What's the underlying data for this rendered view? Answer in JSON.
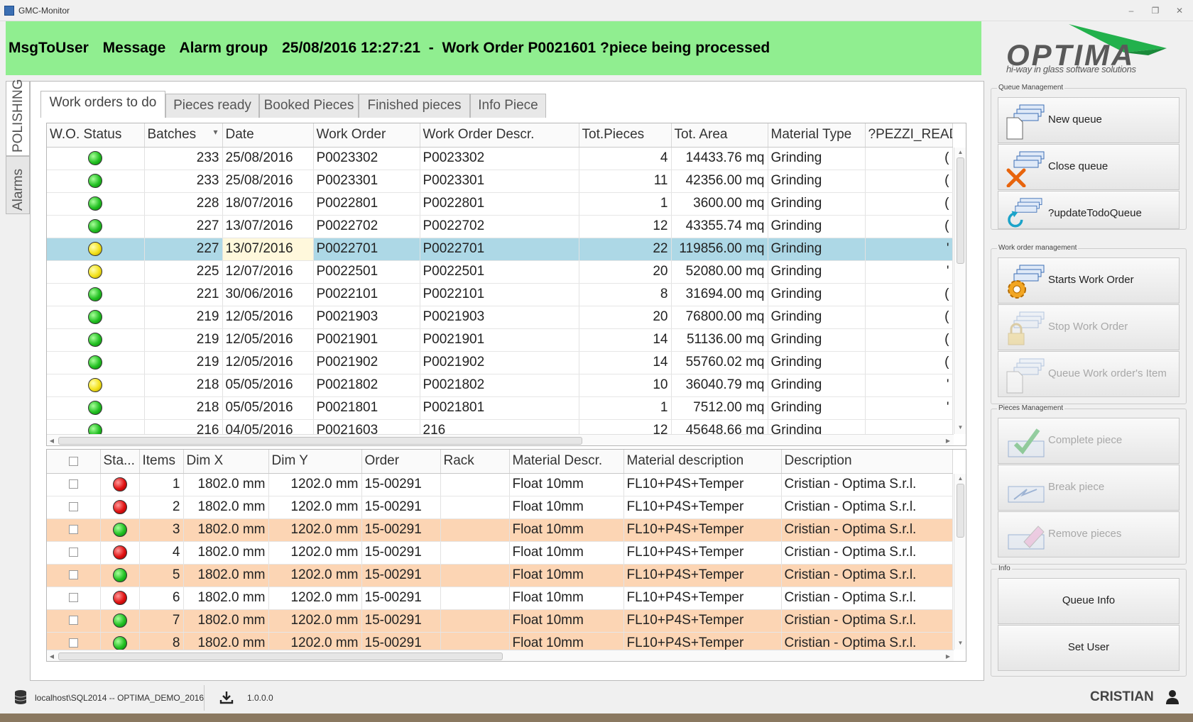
{
  "window": {
    "title": "GMC-Monitor",
    "min": "‒",
    "restore": "❐",
    "close": "✕"
  },
  "banner": {
    "msg_to_user": "MsgToUser",
    "message": "Message",
    "alarm_group": "Alarm group",
    "text": "25/08/2016 12:27:21  -  Work Order P0021601 ?piece being processed",
    "color": "#90ee90"
  },
  "logo": {
    "word": "OPTIMA",
    "tagline": "hi-way in glass software solutions",
    "accent": "#22b14c"
  },
  "side_tabs": [
    "POLISHING",
    "Alarms"
  ],
  "tabs": [
    "Work orders to do",
    "Pieces ready",
    "Booked Pieces",
    "Finished pieces",
    "Info Piece"
  ],
  "work_orders": {
    "columns": [
      "W.O. Status",
      "Batches",
      "Date",
      "Work Order",
      "Work Order Descr.",
      "Tot.Pieces",
      "Tot. Area",
      "Material Type",
      "?PEZZI_READY"
    ],
    "sort_indicator": "▾",
    "rows": [
      {
        "status": "green",
        "batches": "233",
        "date": "25/08/2016",
        "wo": "P0023302",
        "descr": "P0023302",
        "pieces": "4",
        "area": "14433.76 mq",
        "material": "Grinding",
        "ready": "("
      },
      {
        "status": "green",
        "batches": "233",
        "date": "25/08/2016",
        "wo": "P0023301",
        "descr": "P0023301",
        "pieces": "11",
        "area": "42356.00 mq",
        "material": "Grinding",
        "ready": "("
      },
      {
        "status": "green",
        "batches": "228",
        "date": "18/07/2016",
        "wo": "P0022801",
        "descr": "P0022801",
        "pieces": "1",
        "area": "3600.00 mq",
        "material": "Grinding",
        "ready": "("
      },
      {
        "status": "green",
        "batches": "227",
        "date": "13/07/2016",
        "wo": "P0022702",
        "descr": "P0022702",
        "pieces": "12",
        "area": "43355.74 mq",
        "material": "Grinding",
        "ready": "("
      },
      {
        "status": "yellow",
        "batches": "227",
        "date": "13/07/2016",
        "wo": "P0022701",
        "descr": "P0022701",
        "pieces": "22",
        "area": "119856.00 mq",
        "material": "Grinding",
        "ready": "'",
        "selected": true
      },
      {
        "status": "yellow",
        "batches": "225",
        "date": "12/07/2016",
        "wo": "P0022501",
        "descr": "P0022501",
        "pieces": "20",
        "area": "52080.00 mq",
        "material": "Grinding",
        "ready": "'"
      },
      {
        "status": "green",
        "batches": "221",
        "date": "30/06/2016",
        "wo": "P0022101",
        "descr": "P0022101",
        "pieces": "8",
        "area": "31694.00 mq",
        "material": "Grinding",
        "ready": "("
      },
      {
        "status": "green",
        "batches": "219",
        "date": "12/05/2016",
        "wo": "P0021903",
        "descr": "P0021903",
        "pieces": "20",
        "area": "76800.00 mq",
        "material": "Grinding",
        "ready": "("
      },
      {
        "status": "green",
        "batches": "219",
        "date": "12/05/2016",
        "wo": "P0021901",
        "descr": "P0021901",
        "pieces": "14",
        "area": "51136.00 mq",
        "material": "Grinding",
        "ready": "("
      },
      {
        "status": "green",
        "batches": "219",
        "date": "12/05/2016",
        "wo": "P0021902",
        "descr": "P0021902",
        "pieces": "14",
        "area": "55760.02 mq",
        "material": "Grinding",
        "ready": "("
      },
      {
        "status": "yellow",
        "batches": "218",
        "date": "05/05/2016",
        "wo": "P0021802",
        "descr": "P0021802",
        "pieces": "10",
        "area": "36040.79 mq",
        "material": "Grinding",
        "ready": "'"
      },
      {
        "status": "green",
        "batches": "218",
        "date": "05/05/2016",
        "wo": "P0021801",
        "descr": "P0021801",
        "pieces": "1",
        "area": "7512.00 mq",
        "material": "Grinding",
        "ready": "'"
      },
      {
        "status": "green",
        "batches": "216",
        "date": "04/05/2016",
        "wo": "P0021603",
        "descr": "216",
        "pieces": "12",
        "area": "45648.66 mq",
        "material": "Grinding",
        "ready": ""
      }
    ]
  },
  "pieces": {
    "columns": [
      "",
      "Sta...",
      "Items",
      "Dim X",
      "Dim Y",
      "Order",
      "Rack",
      "Material Descr.",
      "Material description",
      "Description"
    ],
    "rows": [
      {
        "status": "red",
        "item": "1",
        "dimx": "1802.0 mm",
        "dimy": "1202.0 mm",
        "order": "15-00291",
        "rack": "",
        "mat": "Float 10mm",
        "matdesc": "FL10+P4S+Temper",
        "desc": "Cristian - Optima S.r.l.",
        "hl": false
      },
      {
        "status": "red",
        "item": "2",
        "dimx": "1802.0 mm",
        "dimy": "1202.0 mm",
        "order": "15-00291",
        "rack": "",
        "mat": "Float 10mm",
        "matdesc": "FL10+P4S+Temper",
        "desc": "Cristian - Optima S.r.l.",
        "hl": false
      },
      {
        "status": "green",
        "item": "3",
        "dimx": "1802.0 mm",
        "dimy": "1202.0 mm",
        "order": "15-00291",
        "rack": "",
        "mat": "Float 10mm",
        "matdesc": "FL10+P4S+Temper",
        "desc": "Cristian - Optima S.r.l.",
        "hl": true
      },
      {
        "status": "red",
        "item": "4",
        "dimx": "1802.0 mm",
        "dimy": "1202.0 mm",
        "order": "15-00291",
        "rack": "",
        "mat": "Float 10mm",
        "matdesc": "FL10+P4S+Temper",
        "desc": "Cristian - Optima S.r.l.",
        "hl": false
      },
      {
        "status": "green",
        "item": "5",
        "dimx": "1802.0 mm",
        "dimy": "1202.0 mm",
        "order": "15-00291",
        "rack": "",
        "mat": "Float 10mm",
        "matdesc": "FL10+P4S+Temper",
        "desc": "Cristian - Optima S.r.l.",
        "hl": true
      },
      {
        "status": "red",
        "item": "6",
        "dimx": "1802.0 mm",
        "dimy": "1202.0 mm",
        "order": "15-00291",
        "rack": "",
        "mat": "Float 10mm",
        "matdesc": "FL10+P4S+Temper",
        "desc": "Cristian - Optima S.r.l.",
        "hl": false
      },
      {
        "status": "green",
        "item": "7",
        "dimx": "1802.0 mm",
        "dimy": "1202.0 mm",
        "order": "15-00291",
        "rack": "",
        "mat": "Float 10mm",
        "matdesc": "FL10+P4S+Temper",
        "desc": "Cristian - Optima S.r.l.",
        "hl": true
      },
      {
        "status": "green",
        "item": "8",
        "dimx": "1802.0 mm",
        "dimy": "1202.0 mm",
        "order": "15-00291",
        "rack": "",
        "mat": "Float 10mm",
        "matdesc": "FL10+P4S+Temper",
        "desc": "Cristian - Optima S.r.l.",
        "hl": true
      }
    ]
  },
  "right_panel": {
    "queue_group": {
      "title": "Queue Management",
      "buttons": [
        {
          "label": "New queue",
          "icon": "new-queue-icon",
          "enabled": true
        },
        {
          "label": "Close queue",
          "icon": "close-queue-icon",
          "enabled": true
        },
        {
          "label": "?updateTodoQueue",
          "icon": "refresh-queue-icon",
          "enabled": true
        }
      ]
    },
    "wo_group": {
      "title": "Work order management",
      "buttons": [
        {
          "label": "Starts Work Order",
          "icon": "gear-icon",
          "enabled": true
        },
        {
          "label": "Stop Work Order",
          "icon": "lock-icon",
          "enabled": false
        },
        {
          "label": "Queue Work order's Item",
          "icon": "queue-item-icon",
          "enabled": false
        }
      ]
    },
    "pieces_group": {
      "title": "Pieces Management",
      "buttons": [
        {
          "label": "Complete piece",
          "icon": "checkmark-icon",
          "enabled": false
        },
        {
          "label": "Break piece",
          "icon": "break-icon",
          "enabled": false
        },
        {
          "label": "Remove pieces",
          "icon": "eraser-icon",
          "enabled": false
        }
      ]
    },
    "info_group": {
      "title": "Info",
      "buttons": [
        {
          "label": "Queue Info",
          "enabled": true
        },
        {
          "label": "Set User",
          "enabled": true
        }
      ]
    }
  },
  "statusbar": {
    "connection": "localhost\\SQL2014 -- OPTIMA_DEMO_2016",
    "version": "1.0.0.0",
    "user": "CRISTIAN"
  }
}
